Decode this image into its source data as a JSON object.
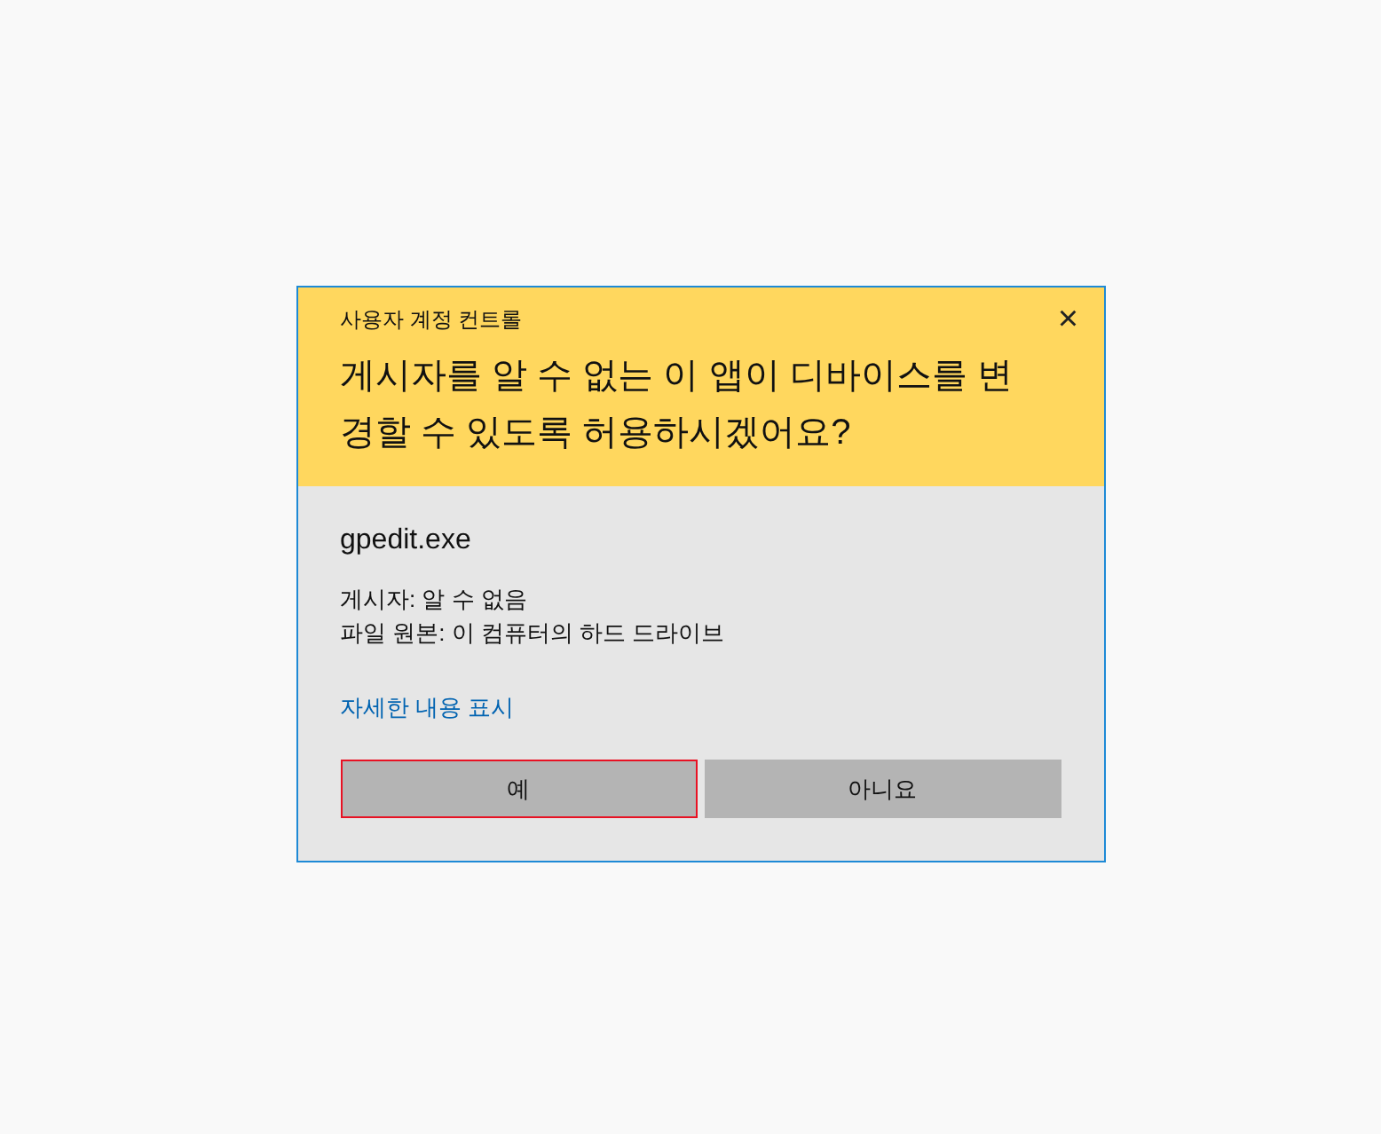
{
  "dialog": {
    "title": "사용자 계정 컨트롤",
    "close": "×",
    "question": "게시자를 알 수 없는 이 앱이 디바이스를 변경할 수 있도록 허용하시겠어요?",
    "program": "gpedit.exe",
    "details": [
      "게시자: 알 수 없음",
      "파일 원본: 이 컴퓨터의 하드 드라이브"
    ],
    "link": "자세한 내용 표시",
    "buttons": [
      {
        "label": "예",
        "focused": true
      },
      {
        "label": "아니요",
        "focused": false
      }
    ]
  }
}
